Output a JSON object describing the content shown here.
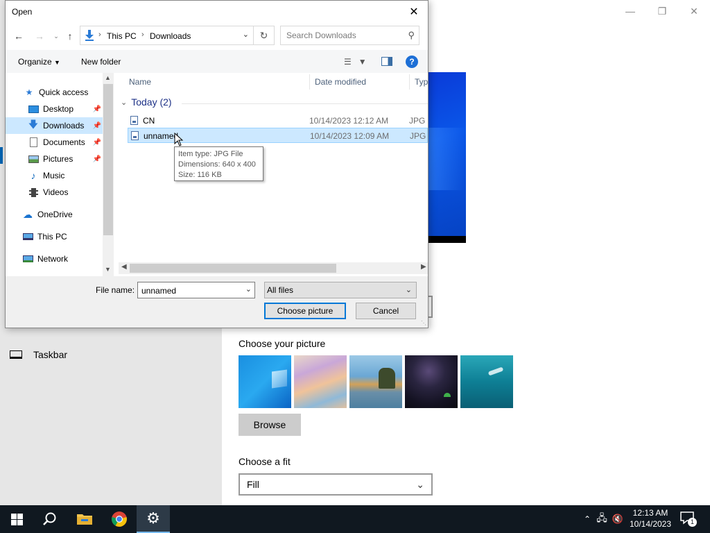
{
  "settings": {
    "sidebar": {
      "taskbar_label": "Taskbar"
    },
    "picture_section": {
      "title": "Choose your picture",
      "thumbnails": [
        "windows-wallpaper",
        "anime-beach-art",
        "beach-rock-arch",
        "night-sky-tent",
        "underwater-swimmer"
      ],
      "browse_label": "Browse"
    },
    "fit_section": {
      "title": "Choose a fit",
      "value": "Fill"
    }
  },
  "dialog": {
    "title": "Open",
    "address": {
      "crumbs": [
        "This PC",
        "Downloads"
      ]
    },
    "search": {
      "placeholder": "Search Downloads"
    },
    "toolbar": {
      "organize": "Organize",
      "new_folder": "New folder",
      "help": "?"
    },
    "nav_pane": {
      "items": [
        {
          "label": "Quick access",
          "icon": "star-icon"
        },
        {
          "label": "Desktop",
          "icon": "desktop-icon",
          "pinned": true
        },
        {
          "label": "Downloads",
          "icon": "download-icon",
          "pinned": true,
          "selected": true
        },
        {
          "label": "Documents",
          "icon": "document-icon",
          "pinned": true
        },
        {
          "label": "Pictures",
          "icon": "pictures-icon",
          "pinned": true
        },
        {
          "label": "Music",
          "icon": "music-icon"
        },
        {
          "label": "Videos",
          "icon": "video-icon"
        },
        {
          "label": "OneDrive",
          "icon": "cloud-icon"
        },
        {
          "label": "This PC",
          "icon": "computer-icon"
        },
        {
          "label": "Network",
          "icon": "network-icon"
        }
      ]
    },
    "columns": [
      "Name",
      "Date modified",
      "Type"
    ],
    "group": {
      "label": "Today (2)"
    },
    "files": [
      {
        "name": "CN",
        "date": "10/14/2023 12:12 AM",
        "type": "JPG File"
      },
      {
        "name": "unnamed",
        "date": "10/14/2023 12:09 AM",
        "type": "JPG File",
        "selected": true
      }
    ],
    "tooltip": {
      "type": "Item type: JPG File",
      "dimensions": "Dimensions: 640 x 400",
      "size": "Size: 116 KB"
    },
    "file_name": {
      "label": "File name:",
      "value": "unnamed"
    },
    "file_type": {
      "value": "All files"
    },
    "buttons": {
      "choose": "Choose picture",
      "cancel": "Cancel"
    }
  },
  "taskbar": {
    "apps": [
      "start-icon",
      "search-icon",
      "file-explorer-icon",
      "chrome-icon",
      "settings-icon"
    ],
    "clock": {
      "time": "12:13 AM",
      "date": "10/14/2023"
    },
    "notifications_count": "1"
  },
  "colors": {
    "accent": "#0078d7",
    "selection": "#cce8ff",
    "taskbar": "#101820"
  }
}
